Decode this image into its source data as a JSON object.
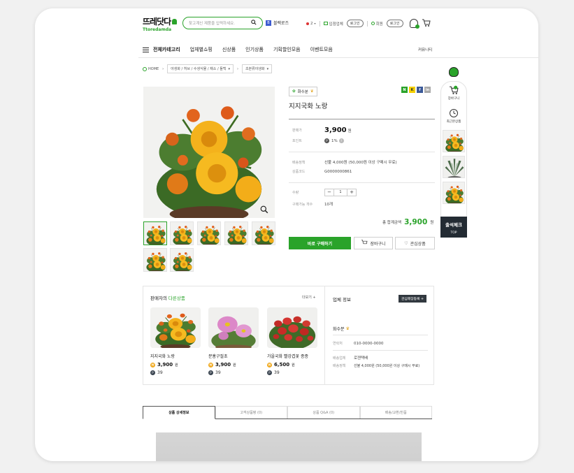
{
  "header": {
    "logo_text": "뜨레닷다",
    "logo_sub": "Ttoredamda",
    "search_placeholder": "찾고계신 제품을 입력하세요.",
    "promo_badge": "B",
    "promo_text": "블랙로즈",
    "lang_count": "2",
    "vendor_label": "입점업체",
    "vendor_login": "로그인",
    "member_label": "회원",
    "member_login": "로그인"
  },
  "nav": {
    "all_categories": "전체카테고리",
    "items": [
      "업체별쇼핑",
      "신상품",
      "인기상품",
      "기획할인모음",
      "이벤트모음"
    ],
    "community": "커뮤니티"
  },
  "breadcrumb": {
    "home": "HOME",
    "level1": "야생화 / 허브 / 수생식물 / 채소 / 돌백",
    "level2": "초본류야생화"
  },
  "product": {
    "seller": "화수분",
    "name": "지지국화 노랑",
    "price_label": "판매가",
    "price": "3,900",
    "price_unit": "원",
    "point_label": "포인트",
    "point_value": "1%",
    "shipping_label": "배송정책",
    "shipping_value": "선불 4,000원 (50,000원 이상 구매시 무료)",
    "code_label": "상품코드",
    "code_value": "G0000000861",
    "qty_label": "수량",
    "qty_value": "1",
    "stock_label": "구매가능 개수",
    "stock_value": "10개",
    "total_label": "총 합계금액",
    "total_value": "3,900",
    "total_unit": "원",
    "buy_label": "바로 구매하기",
    "cart_label": "장바구니",
    "wish_label": "관심상품"
  },
  "share": [
    "N",
    "K",
    "f",
    "in"
  ],
  "sidebar": {
    "cart_label": "장바구니",
    "recent_label": "최근본상품",
    "attend_label": "출석체크",
    "top_label": "TOP"
  },
  "other_products": {
    "title_prefix": "판매자의",
    "title_accent": "다른상품",
    "more_label": "더보기 +",
    "items": [
      {
        "name": "지지국화 노랑",
        "price": "3,900",
        "unit": "원",
        "point": "39"
      },
      {
        "name": "분홍구절초",
        "price": "3,900",
        "unit": "원",
        "point": "39"
      },
      {
        "name": "가을국화 빨강겹꽃 종종",
        "price": "6,500",
        "unit": "원",
        "point": "39"
      }
    ]
  },
  "vendor": {
    "title": "업체 정보",
    "fav_button": "관심매장등록 +",
    "name": "화수분",
    "contact_label": "연락처",
    "contact_value": "010-0000-0000",
    "courier_label": "배송업체",
    "courier_value": "로젠택배",
    "policy_label": "배송정책",
    "policy_value": "선불 4,000원 (50,000원 이상 구매시 무료)"
  },
  "tabs": [
    "상품 상세정보",
    "고객상품평 (0)",
    "상품 Q&A (0)",
    "배송/교환/반품"
  ],
  "colors": {
    "accent": "#2aa32a",
    "dark": "#232b33"
  }
}
